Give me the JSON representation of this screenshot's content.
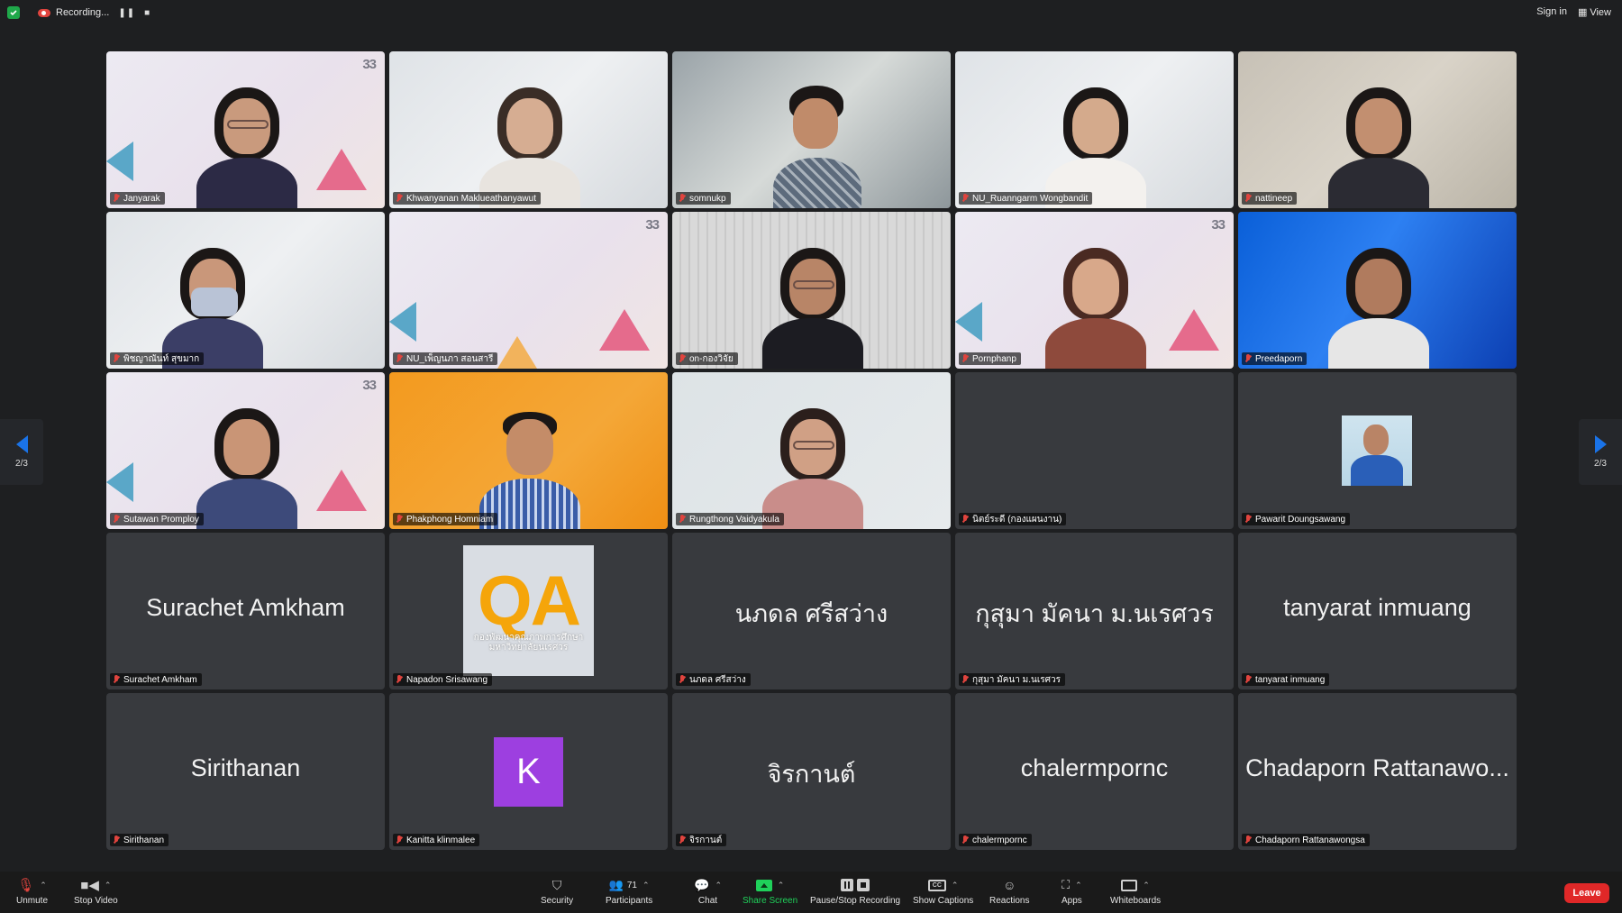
{
  "topbar": {
    "recording_label": "Recording...",
    "sign_in": "Sign in",
    "view": "View"
  },
  "nav": {
    "page_left": "2/3",
    "page_right": "2/3"
  },
  "participants": [
    {
      "name": "Janyarak"
    },
    {
      "name": "Khwanyanan Maklueathanyawut"
    },
    {
      "name": "somnukp"
    },
    {
      "name": "NU_Ruanngarm Wongbandit"
    },
    {
      "name": "nattineep"
    },
    {
      "name": "พิชญาณันท์ สุขมาก"
    },
    {
      "name": "NU_เพ็ญนภา สอนสารี"
    },
    {
      "name": "on-กองวิจัย"
    },
    {
      "name": "Pornphanp"
    },
    {
      "name": "Preedaporn"
    },
    {
      "name": "Sutawan Promploy"
    },
    {
      "name": "Phakphong Homniam"
    },
    {
      "name": "Rungthong Vaidyakula"
    },
    {
      "name": "นิตย์ระดี (กองแผนงาน)"
    },
    {
      "name": "Pawarit Doungsawang"
    },
    {
      "name": "Surachet Amkham",
      "display": "Surachet Amkham"
    },
    {
      "name": "Napadon Srisawang",
      "avatar_letters": "QA",
      "avatar_caption": "กองพัฒนาคุณภาพการศึกษา มหาวิทยาลัยนเรศวร"
    },
    {
      "name": "นภดล ศรีสว่าง",
      "display": "นภดล ศรีสว่าง"
    },
    {
      "name": "กุสุมา มัคนา ม.นเรศวร",
      "display": "กุสุมา มัคนา ม.นเรศวร"
    },
    {
      "name": "tanyarat inmuang",
      "display": "tanyarat inmuang"
    },
    {
      "name": "Sirithanan",
      "display": "Sirithanan"
    },
    {
      "name": "Kanitta klinmalee",
      "avatar_letter": "K"
    },
    {
      "name": "จิรกานต์",
      "display": "จิรกานต์"
    },
    {
      "name": "chalermpornc",
      "display": "chalermpornc"
    },
    {
      "name": "Chadaporn Rattanawongsa",
      "display": "Chadaporn Rattanawo..."
    }
  ],
  "tiles_extra": {
    "logo_text": "33"
  },
  "toolbar": {
    "unmute": "Unmute",
    "stop_video": "Stop Video",
    "security": "Security",
    "participants": "Participants",
    "participants_count": "71",
    "chat": "Chat",
    "share_screen": "Share Screen",
    "pause_stop_recording": "Pause/Stop Recording",
    "show_captions": "Show Captions",
    "reactions": "Reactions",
    "apps": "Apps",
    "whiteboards": "Whiteboards",
    "leave": "Leave"
  },
  "colors": {
    "share_green": "#1fd15a",
    "leave_red": "#e02828",
    "nav_blue": "#1a73e8",
    "avatar_purple": "#9d3fe0",
    "qa_orange": "#f5a50a"
  }
}
